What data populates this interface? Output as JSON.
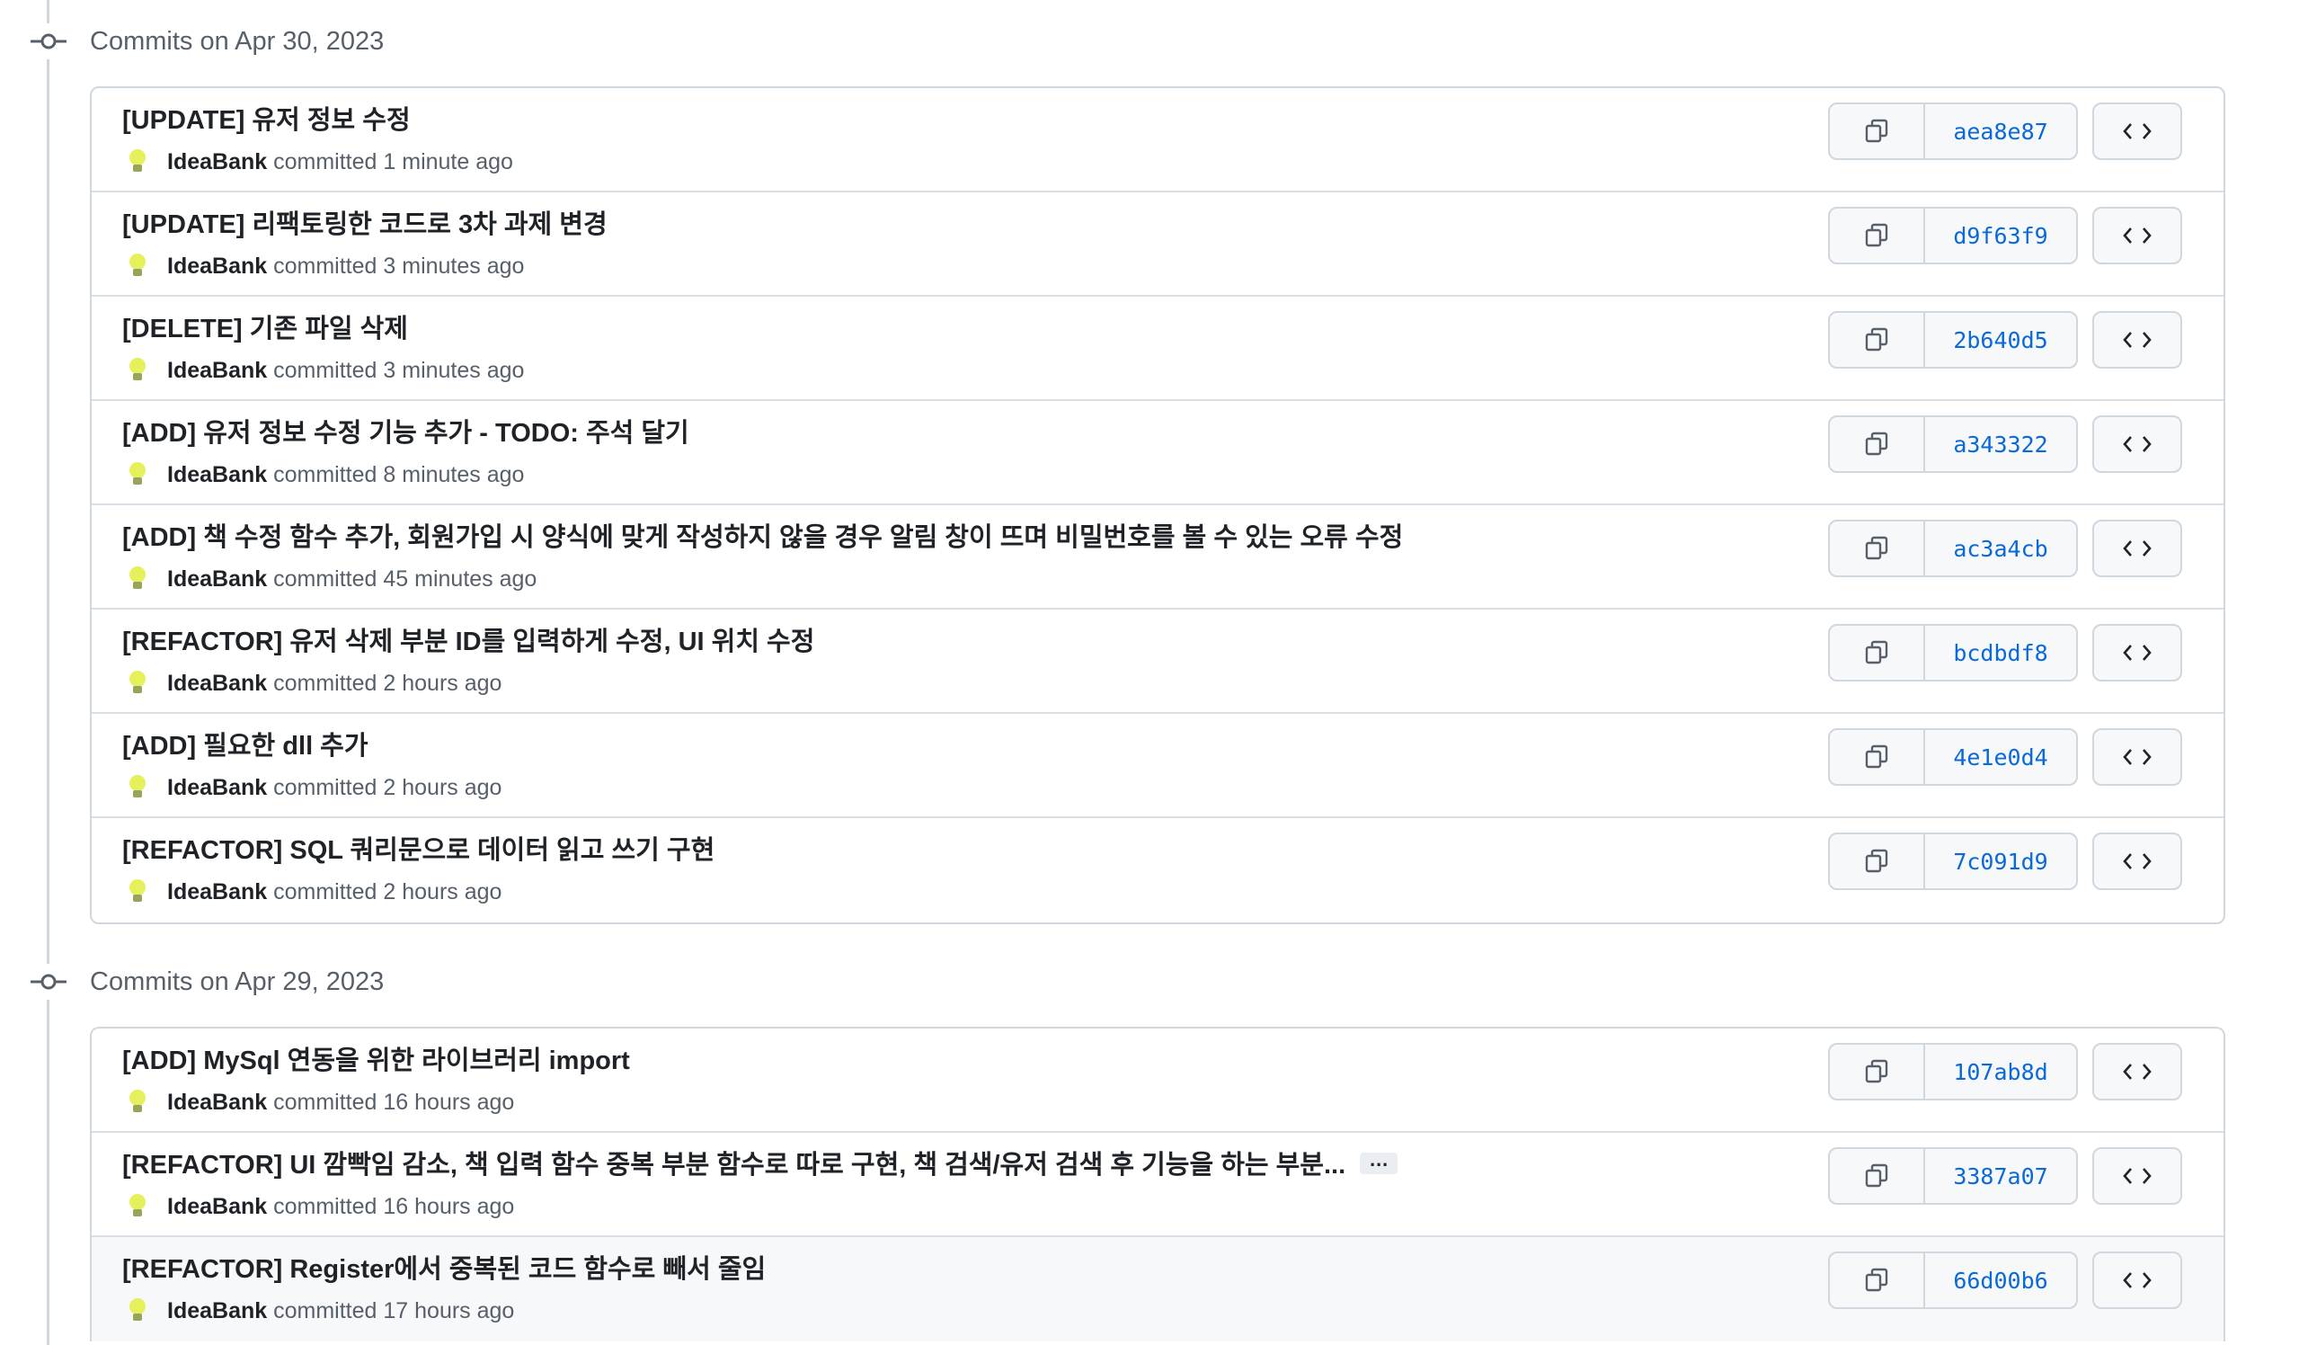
{
  "groups": [
    {
      "title": "Commits on Apr 30, 2023",
      "commits": [
        {
          "message": "[UPDATE] 유저 정보 수정",
          "author": "IdeaBank",
          "verb": "committed",
          "time": "1 minute ago",
          "sha": "aea8e87"
        },
        {
          "message": "[UPDATE] 리팩토링한 코드로 3차 과제 변경",
          "author": "IdeaBank",
          "verb": "committed",
          "time": "3 minutes ago",
          "sha": "d9f63f9"
        },
        {
          "message": "[DELETE] 기존 파일 삭제",
          "author": "IdeaBank",
          "verb": "committed",
          "time": "3 minutes ago",
          "sha": "2b640d5"
        },
        {
          "message": "[ADD] 유저 정보 수정 기능 추가 - TODO: 주석 달기",
          "author": "IdeaBank",
          "verb": "committed",
          "time": "8 minutes ago",
          "sha": "a343322"
        },
        {
          "message": "[ADD] 책 수정 함수 추가, 회원가입 시 양식에 맞게 작성하지 않을 경우 알림 창이 뜨며 비밀번호를 볼 수 있는 오류 수정",
          "author": "IdeaBank",
          "verb": "committed",
          "time": "45 minutes ago",
          "sha": "ac3a4cb"
        },
        {
          "message": "[REFACTOR] 유저 삭제 부분 ID를 입력하게 수정, UI 위치 수정",
          "author": "IdeaBank",
          "verb": "committed",
          "time": "2 hours ago",
          "sha": "bcdbdf8"
        },
        {
          "message": "[ADD] 필요한 dll 추가",
          "author": "IdeaBank",
          "verb": "committed",
          "time": "2 hours ago",
          "sha": "4e1e0d4"
        },
        {
          "message": "[REFACTOR] SQL 쿼리문으로 데이터 읽고 쓰기 구현",
          "author": "IdeaBank",
          "verb": "committed",
          "time": "2 hours ago",
          "sha": "7c091d9"
        }
      ]
    },
    {
      "title": "Commits on Apr 29, 2023",
      "commits": [
        {
          "message": "[ADD] MySql 연동을 위한 라이브러리 import",
          "author": "IdeaBank",
          "verb": "committed",
          "time": "16 hours ago",
          "sha": "107ab8d"
        },
        {
          "message": "[REFACTOR] UI 깜빡임 감소, 책 입력 함수 중복 부분 함수로 따로 구현, 책 검색/유저 검색 후 기능을 하는 부분...",
          "author": "IdeaBank",
          "verb": "committed",
          "time": "16 hours ago",
          "sha": "3387a07",
          "ellipsis": "…"
        },
        {
          "message": "[REFACTOR] Register에서 중복된 코드 함수로 빼서 줄임",
          "author": "IdeaBank",
          "verb": "committed",
          "time": "17 hours ago",
          "sha": "66d00b6"
        }
      ]
    }
  ],
  "icons": {
    "timeline": "git-commit-icon",
    "avatar": "lightbulb-avatar",
    "copy": "copy-icon",
    "browse": "code-icon"
  },
  "colors": {
    "link": "#0969da",
    "muted": "#57606a",
    "border": "#d0d7de",
    "avatar": "#e6f05a"
  }
}
